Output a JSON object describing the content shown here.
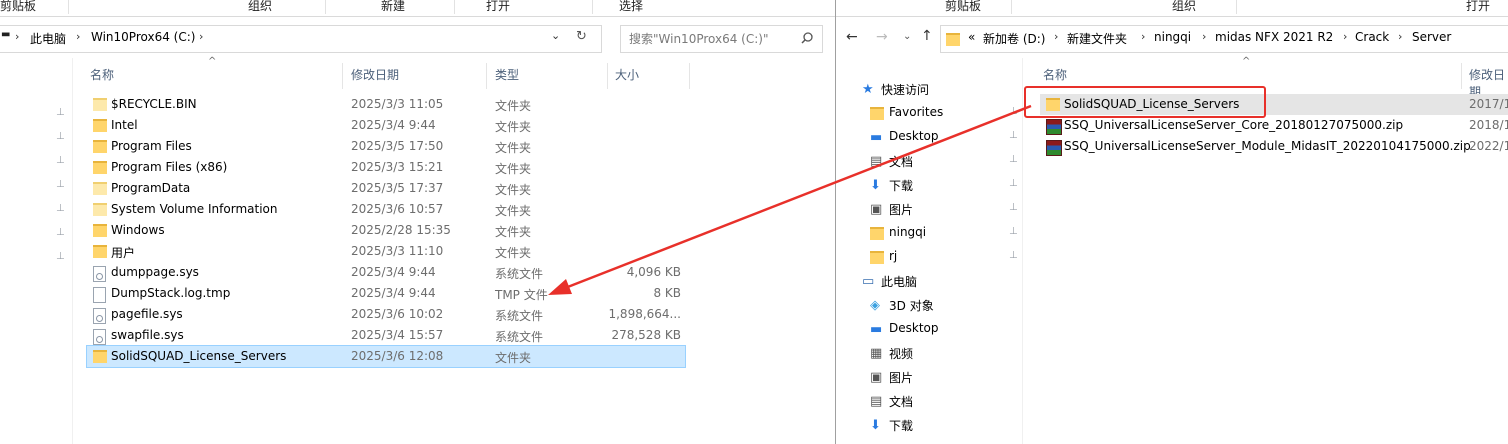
{
  "left": {
    "ribbon": [
      "剪贴板",
      "组织",
      "新建",
      "打开",
      "选择"
    ],
    "address": {
      "crumbs": [
        "此电脑",
        "Win10Prox64 (C:)"
      ]
    },
    "search": {
      "placeholder": "搜索\"Win10Prox64 (C:)\""
    },
    "columns": {
      "name": "名称",
      "date": "修改日期",
      "type": "类型",
      "size": "大小"
    },
    "files": [
      {
        "name": "$RECYCLE.BIN",
        "date": "2025/3/3 11:05",
        "type": "文件夹",
        "size": "",
        "icon": "folder-pale-icon"
      },
      {
        "name": "Intel",
        "date": "2025/3/4 9:44",
        "type": "文件夹",
        "size": "",
        "icon": "folder-icon"
      },
      {
        "name": "Program Files",
        "date": "2025/3/5 17:50",
        "type": "文件夹",
        "size": "",
        "icon": "folder-icon"
      },
      {
        "name": "Program Files (x86)",
        "date": "2025/3/3 15:21",
        "type": "文件夹",
        "size": "",
        "icon": "folder-icon"
      },
      {
        "name": "ProgramData",
        "date": "2025/3/5 17:37",
        "type": "文件夹",
        "size": "",
        "icon": "folder-pale-icon"
      },
      {
        "name": "System Volume Information",
        "date": "2025/3/6 10:57",
        "type": "文件夹",
        "size": "",
        "icon": "folder-pale-icon"
      },
      {
        "name": "Windows",
        "date": "2025/2/28 15:35",
        "type": "文件夹",
        "size": "",
        "icon": "folder-icon"
      },
      {
        "name": "用户",
        "date": "2025/3/3 11:10",
        "type": "文件夹",
        "size": "",
        "icon": "folder-icon"
      },
      {
        "name": "dumppage.sys",
        "date": "2025/3/4 9:44",
        "type": "系统文件",
        "size": "4,096 KB",
        "icon": "system-file-icon"
      },
      {
        "name": "DumpStack.log.tmp",
        "date": "2025/3/4 9:44",
        "type": "TMP 文件",
        "size": "8 KB",
        "icon": "file-icon"
      },
      {
        "name": "pagefile.sys",
        "date": "2025/3/6 10:02",
        "type": "系统文件",
        "size": "1,898,664...",
        "icon": "system-file-icon"
      },
      {
        "name": "swapfile.sys",
        "date": "2025/3/4 15:57",
        "type": "系统文件",
        "size": "278,528 KB",
        "icon": "system-file-icon"
      },
      {
        "name": "SolidSQUAD_License_Servers",
        "date": "2025/3/6 12:08",
        "type": "文件夹",
        "size": "",
        "icon": "folder-icon",
        "selected": true
      }
    ]
  },
  "right": {
    "ribbon": [
      "剪贴板",
      "组织",
      "打开"
    ],
    "address": {
      "prefix": "«",
      "crumbs": [
        "新加卷 (D:)",
        "新建文件夹",
        "ningqi",
        "midas NFX 2021 R2",
        "Crack",
        "Server"
      ]
    },
    "columns": {
      "name": "名称",
      "date": "修改日期"
    },
    "files": [
      {
        "name": "SolidSQUAD_License_Servers",
        "date": "2017/1",
        "icon": "folder-icon",
        "selected": true
      },
      {
        "name": "SSQ_UniversalLicenseServer_Core_20180127075000.zip",
        "date": "2018/1",
        "icon": "zip-archive-icon"
      },
      {
        "name": "SSQ_UniversalLicenseServer_Module_MidasIT_20220104175000.zip",
        "date": "2022/1",
        "icon": "zip-archive-icon"
      }
    ],
    "nav": [
      {
        "label": "快速访问",
        "icon": "star-icon",
        "indent": 0,
        "pinned": false
      },
      {
        "label": "Favorites",
        "icon": "folder-icon",
        "indent": 1,
        "pinned": true
      },
      {
        "label": "Desktop",
        "icon": "desktop-icon",
        "indent": 1,
        "pinned": true
      },
      {
        "label": "文档",
        "icon": "document-icon",
        "indent": 1,
        "pinned": true
      },
      {
        "label": "下载",
        "icon": "download-icon",
        "indent": 1,
        "pinned": true
      },
      {
        "label": "图片",
        "icon": "picture-icon",
        "indent": 1,
        "pinned": true
      },
      {
        "label": "ningqi",
        "icon": "folder-icon",
        "indent": 1,
        "pinned": true
      },
      {
        "label": "rj",
        "icon": "folder-icon",
        "indent": 1,
        "pinned": true
      },
      {
        "label": "此电脑",
        "icon": "computer-icon",
        "indent": 0,
        "pinned": false
      },
      {
        "label": "3D 对象",
        "icon": "3d-objects-icon",
        "indent": 1,
        "pinned": false
      },
      {
        "label": "Desktop",
        "icon": "desktop-icon",
        "indent": 1,
        "pinned": false
      },
      {
        "label": "视频",
        "icon": "video-icon",
        "indent": 1,
        "pinned": false
      },
      {
        "label": "图片",
        "icon": "picture-icon",
        "indent": 1,
        "pinned": false
      },
      {
        "label": "文档",
        "icon": "document-icon",
        "indent": 1,
        "pinned": false
      },
      {
        "label": "下载",
        "icon": "download-icon",
        "indent": 1,
        "pinned": false
      }
    ]
  },
  "colors": {
    "selection": "#cce8ff",
    "selection_border": "#99d1ff",
    "annotation": "#e8302a",
    "hover_row": "#e5e5e5"
  }
}
